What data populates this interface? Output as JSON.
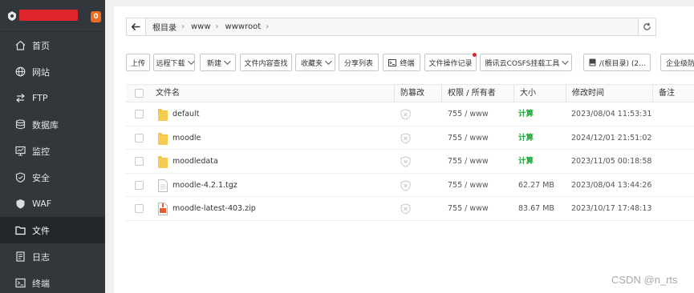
{
  "sidebar": {
    "badge": "0",
    "items": [
      {
        "label": "首页",
        "icon": "home-icon"
      },
      {
        "label": "网站",
        "icon": "globe-icon"
      },
      {
        "label": "FTP",
        "icon": "ftp-icon"
      },
      {
        "label": "数据库",
        "icon": "database-icon"
      },
      {
        "label": "监控",
        "icon": "monitor-icon"
      },
      {
        "label": "安全",
        "icon": "shield-icon"
      },
      {
        "label": "WAF",
        "icon": "waf-icon"
      },
      {
        "label": "文件",
        "icon": "folder-icon",
        "active": true
      },
      {
        "label": "日志",
        "icon": "log-icon"
      },
      {
        "label": "终端",
        "icon": "terminal-icon"
      }
    ]
  },
  "path": {
    "crumbs": [
      "根目录",
      "www",
      "wwwroot"
    ]
  },
  "toolbar": {
    "upload": "上传",
    "remote_download": "远程下载",
    "new": "新建",
    "content_search": "文件内容查找",
    "favorites": "收藏夹",
    "share_list": "分享列表",
    "terminal": "终端",
    "op_log": "文件操作记录",
    "cosfs": "腾讯云COSFS挂载工具",
    "disk": "/(根目录) (2...",
    "enterprise": "企业级防"
  },
  "table": {
    "headers": {
      "name": "文件名",
      "tamper": "防篡改",
      "perm": "权限 / 所有者",
      "size": "大小",
      "mtime": "修改时间",
      "note": "备注"
    },
    "rows": [
      {
        "name": "default",
        "type": "folder",
        "perm": "755 / www",
        "size": "计算",
        "mtime": "2023/08/04 11:53:31"
      },
      {
        "name": "moodle",
        "type": "folder",
        "perm": "755 / www",
        "size": "计算",
        "mtime": "2024/12/01 21:51:02"
      },
      {
        "name": "moodledata",
        "type": "folder",
        "perm": "755 / www",
        "size": "计算",
        "mtime": "2023/11/05 00:18:58"
      },
      {
        "name": "moodle-4.2.1.tgz",
        "type": "file",
        "perm": "755 / www",
        "size": "62.27 MB",
        "mtime": "2023/08/04 13:44:26"
      },
      {
        "name": "moodle-latest-403.zip",
        "type": "zip",
        "perm": "755 / www",
        "size": "83.67 MB",
        "mtime": "2023/10/17 17:48:13"
      }
    ]
  },
  "watermark": "CSDN @n_rts",
  "colors": {
    "sidebar_bg": "#32373c",
    "accent_green": "#20a53a",
    "badge_orange": "#f06a1f",
    "folder_yellow": "#f5c342"
  }
}
